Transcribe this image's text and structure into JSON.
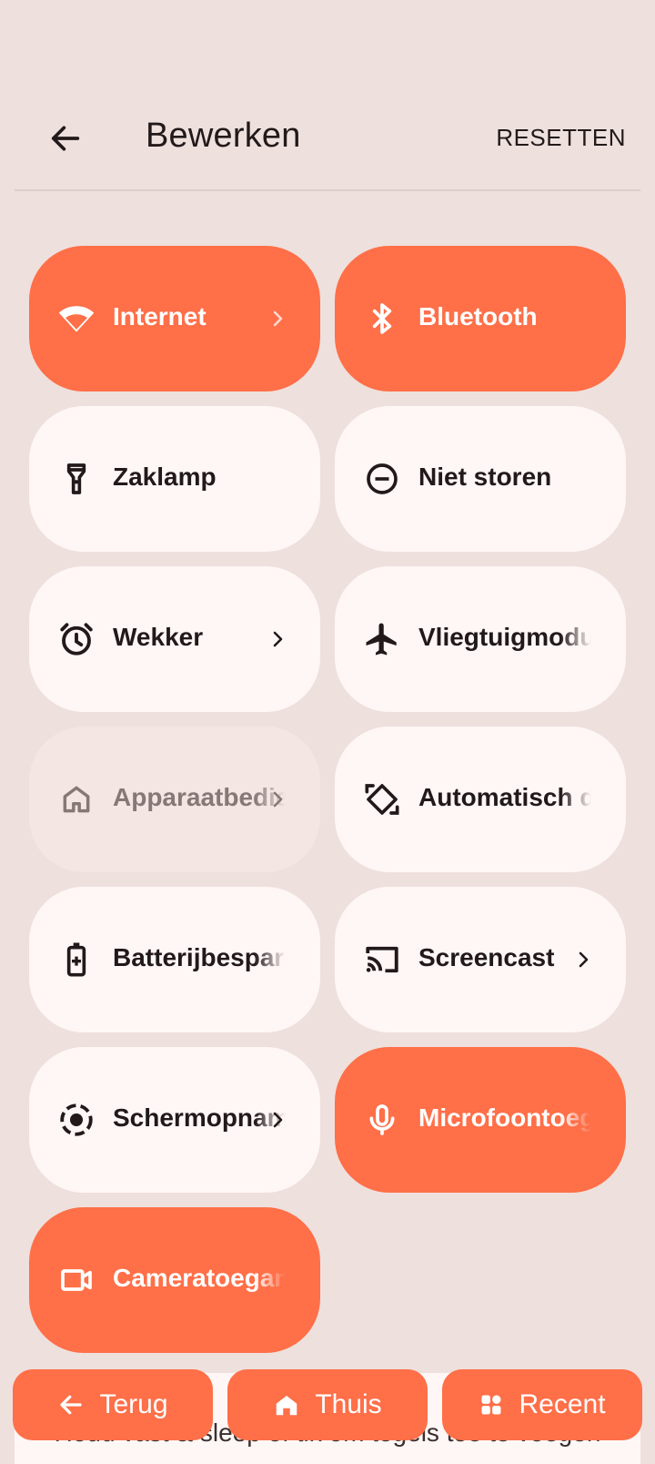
{
  "header": {
    "title": "Bewerken",
    "reset_label": "RESETTEN"
  },
  "colors": {
    "accent": "#ff6f48",
    "tile": "#fff7f5",
    "background": "#eee0dd"
  },
  "tiles": [
    {
      "label": "Internet",
      "icon": "wifi-icon",
      "state": "active",
      "chevron": true
    },
    {
      "label": "Bluetooth",
      "icon": "bluetooth-icon",
      "state": "active",
      "chevron": false
    },
    {
      "label": "Zaklamp",
      "icon": "flashlight-icon",
      "state": "inactive",
      "chevron": false
    },
    {
      "label": "Niet storen",
      "icon": "do-not-disturb-icon",
      "state": "inactive",
      "chevron": false
    },
    {
      "label": "Wekker",
      "icon": "alarm-icon",
      "state": "inactive",
      "chevron": true
    },
    {
      "label": "Vliegtuigmodus",
      "icon": "airplane-icon",
      "state": "inactive",
      "chevron": false
    },
    {
      "label": "Apparaatbediening",
      "icon": "home-icon",
      "state": "disabled",
      "chevron": true
    },
    {
      "label": "Automatisch draaien",
      "icon": "auto-rotate-icon",
      "state": "inactive",
      "chevron": false
    },
    {
      "label": "Batterijbesparing",
      "icon": "battery-saver-icon",
      "state": "inactive",
      "chevron": false
    },
    {
      "label": "Screencast",
      "icon": "cast-icon",
      "state": "inactive",
      "chevron": true
    },
    {
      "label": "Schermopname",
      "icon": "screen-record-icon",
      "state": "inactive",
      "chevron": true
    },
    {
      "label": "Microfoontoegang",
      "icon": "microphone-icon",
      "state": "active",
      "chevron": false
    },
    {
      "label": "Cameratoegang",
      "icon": "video-camera-icon",
      "state": "active",
      "chevron": false
    }
  ],
  "hint": {
    "text": "Houd vast & sleep of tik om tegels toe te voegen"
  },
  "navbar": {
    "back_label": "Terug",
    "home_label": "Thuis",
    "recent_label": "Recent"
  }
}
